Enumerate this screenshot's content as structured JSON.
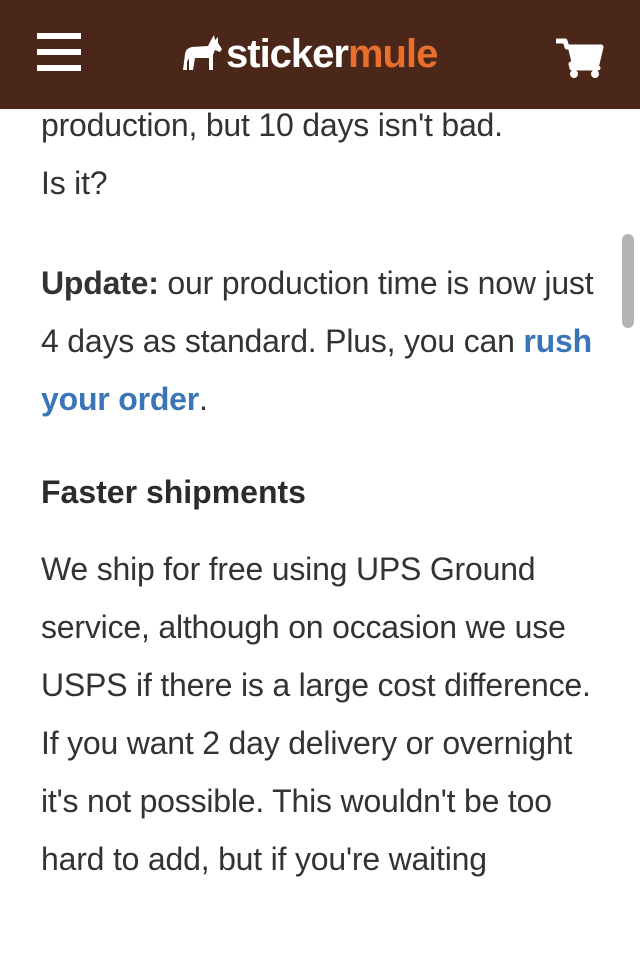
{
  "header": {
    "brand_part1": "sticker",
    "brand_part2": "mule",
    "menu_icon": "hamburger-menu-icon",
    "cart_icon": "shopping-cart-icon",
    "logo_icon": "mule-icon",
    "background_color": "#4a2718",
    "accent_color": "#e96f2c"
  },
  "article": {
    "intro": {
      "line1": "production, but 10 days isn't bad.",
      "line2": "Is it?"
    },
    "update": {
      "label": "Update:",
      "text": " our production time is now just 4 days as standard. Plus, you can ",
      "link_text": "rush your order",
      "suffix": "."
    },
    "heading": "Faster shipments",
    "shipping_paragraph": "We ship for free using UPS Ground service, although on occasion we use USPS if there is a large cost difference. If you want 2 day delivery or overnight it's not possible. This wouldn't be too hard to add, but if you're waiting"
  },
  "colors": {
    "link": "#3a75b8",
    "text": "#333333"
  }
}
